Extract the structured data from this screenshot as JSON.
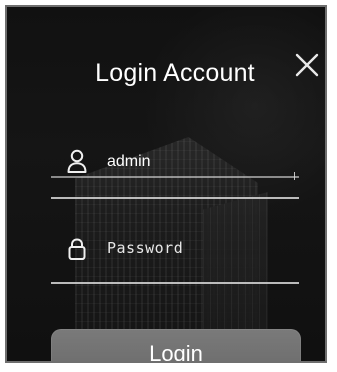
{
  "dialog": {
    "title": "Login Account",
    "close_icon": "close-icon"
  },
  "form": {
    "username": {
      "icon": "user-icon",
      "value": "admin"
    },
    "password": {
      "icon": "lock-icon",
      "placeholder": "Password"
    },
    "submit_label": "Login"
  },
  "colors": {
    "background": "#121212",
    "text": "#ffffff",
    "button": "#707070",
    "border": "#6f6f6f",
    "underline": "#d8d8d8"
  }
}
